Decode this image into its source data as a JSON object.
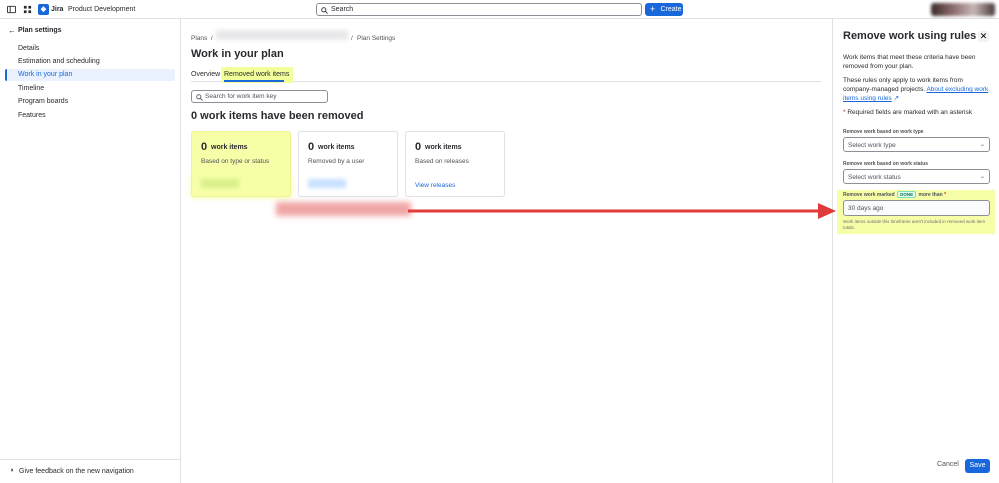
{
  "topbar": {
    "brand": "Jira",
    "project": "Product Development",
    "search_placeholder": "Search",
    "create_label": "Create"
  },
  "sidebar": {
    "back_label": "Plan settings",
    "items": [
      {
        "label": "Details"
      },
      {
        "label": "Estimation and scheduling"
      },
      {
        "label": "Work in your plan",
        "active": true
      },
      {
        "label": "Timeline"
      },
      {
        "label": "Program boards"
      },
      {
        "label": "Features"
      }
    ],
    "feedback_label": "Give feedback on the new navigation"
  },
  "main": {
    "breadcrumb": {
      "root": "Plans",
      "settings": "Plan Settings"
    },
    "title": "Work in your plan",
    "tabs": [
      {
        "label": "Overview"
      },
      {
        "label": "Removed work items",
        "active": true
      }
    ],
    "search_placeholder": "Search for work item key",
    "heading": "0 work items have been removed",
    "cards": [
      {
        "count": "0",
        "unit": "work items",
        "desc": "Based on type or status",
        "highlighted": true
      },
      {
        "count": "0",
        "unit": "work items",
        "desc": "Removed by a user"
      },
      {
        "count": "0",
        "unit": "work items",
        "desc": "Based on releases",
        "link": "View releases"
      }
    ]
  },
  "panel": {
    "title": "Remove work using rules",
    "intro": "Work items that meet these criteria have been removed from your plan.",
    "rules_note": "These rules only apply to work items from company-managed projects.",
    "rules_link": "About excluding work items using rules",
    "required_note": "Required fields are marked with an asterisk",
    "type_label": "Remove work based on work type",
    "type_placeholder": "Select work type",
    "status_label": "Remove work based on work status",
    "status_placeholder": "Select work status",
    "done_label_prefix": "Remove work marked",
    "done_badge": "DONE",
    "done_label_suffix": "more than",
    "done_value": "30 days ago",
    "done_help": "Work items outside this timeframe aren't included in removed work item totals.",
    "cancel_label": "Cancel",
    "save_label": "Save"
  },
  "colors": {
    "accent": "#1868db",
    "highlight": "#f6ffa8",
    "arrow": "#e03a3a"
  }
}
